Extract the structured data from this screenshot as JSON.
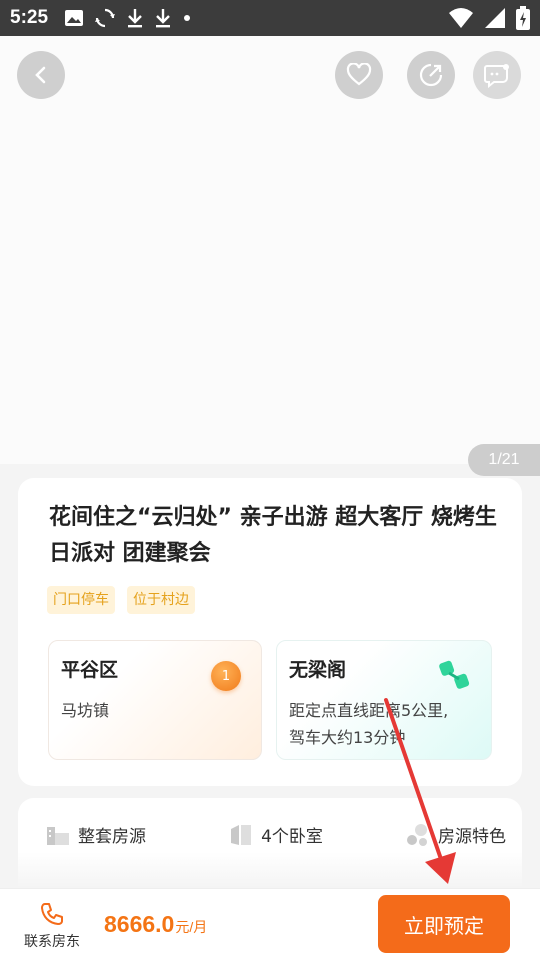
{
  "status_bar": {
    "time": "5:25"
  },
  "gallery": {
    "counter": "1/21"
  },
  "listing": {
    "title": "花间住之“云归处” 亲子出游 超大客厅 烧烤生日派对 团建聚会",
    "tags": [
      "门口停车",
      "位于村边"
    ],
    "location": {
      "district": "平谷区",
      "town": "马坊镇",
      "badge": "1"
    },
    "landmark": {
      "name": "无梁阁",
      "distance": "距定点直线距离5公里,驾车大约13分钟"
    }
  },
  "features": [
    "整套房源",
    "4个卧室",
    "房源特色"
  ],
  "bottom_bar": {
    "contact_label": "联系房东",
    "price": "8666.0",
    "price_unit": "元/月",
    "book_label": "立即预定"
  },
  "colors": {
    "accent": "#f46b1a",
    "tag_text": "#e5a21d",
    "tag_bg": "#fff3d9",
    "arrow": "#e53935"
  }
}
